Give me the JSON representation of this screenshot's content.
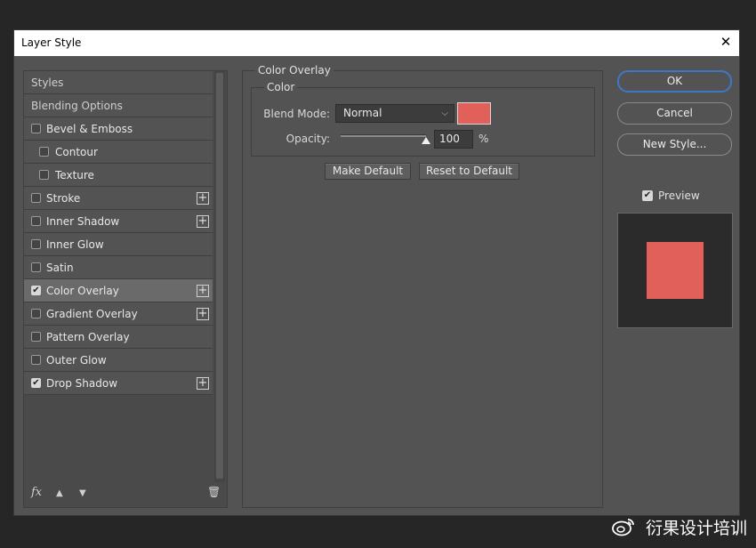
{
  "window": {
    "title": "Layer Style"
  },
  "styles_list": [
    {
      "label": "Styles",
      "type": "header"
    },
    {
      "label": "Blending Options",
      "type": "header"
    },
    {
      "label": "Bevel & Emboss",
      "checked": false,
      "plus": false
    },
    {
      "label": "Contour",
      "checked": false,
      "plus": false,
      "sub": true
    },
    {
      "label": "Texture",
      "checked": false,
      "plus": false,
      "sub": true
    },
    {
      "label": "Stroke",
      "checked": false,
      "plus": true
    },
    {
      "label": "Inner Shadow",
      "checked": false,
      "plus": true
    },
    {
      "label": "Inner Glow",
      "checked": false,
      "plus": false
    },
    {
      "label": "Satin",
      "checked": false,
      "plus": false
    },
    {
      "label": "Color Overlay",
      "checked": true,
      "plus": true,
      "active": true
    },
    {
      "label": "Gradient Overlay",
      "checked": false,
      "plus": true
    },
    {
      "label": "Pattern Overlay",
      "checked": false,
      "plus": false
    },
    {
      "label": "Outer Glow",
      "checked": false,
      "plus": false
    },
    {
      "label": "Drop Shadow",
      "checked": true,
      "plus": true
    }
  ],
  "panel_footer": {
    "fx_label": "fx",
    "up_icon": "▲",
    "down_icon": "▼",
    "trash_icon": "🗑"
  },
  "color_overlay": {
    "section_title": "Color Overlay",
    "group_title": "Color",
    "blend_mode_label": "Blend Mode:",
    "blend_mode_value": "Normal",
    "overlay_color": "#e1605a",
    "opacity_label": "Opacity:",
    "opacity_value": "100",
    "opacity_unit": "%",
    "opacity_level": 1.0,
    "make_default_label": "Make Default",
    "reset_default_label": "Reset to Default"
  },
  "actions": {
    "ok_label": "OK",
    "cancel_label": "Cancel",
    "new_style_label": "New Style...",
    "preview_label": "Preview",
    "preview_checked": true
  },
  "watermark": {
    "text": "衍果设计培训"
  }
}
